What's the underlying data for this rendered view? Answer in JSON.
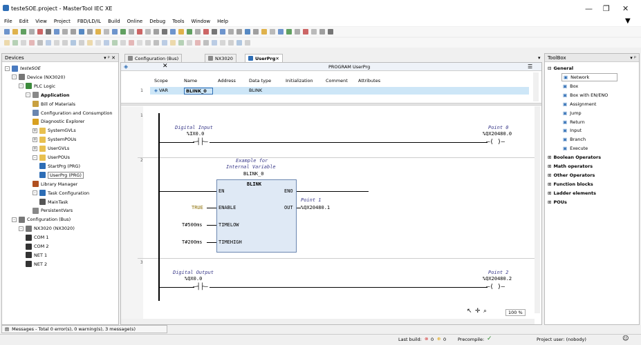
{
  "window": {
    "title": "testeSOE.project - MasterTool IEC XE"
  },
  "menu": [
    "File",
    "Edit",
    "View",
    "Project",
    "FBD/LD/IL",
    "Build",
    "Online",
    "Debug",
    "Tools",
    "Window",
    "Help"
  ],
  "devices_panel": {
    "title": "Devices",
    "tree": [
      {
        "label": "testeSOE",
        "level": 0,
        "icon": "project-icon",
        "exp": "-"
      },
      {
        "label": "Device (NX3020)",
        "level": 1,
        "icon": "device-icon",
        "exp": "-"
      },
      {
        "label": "PLC Logic",
        "level": 2,
        "icon": "plc-logic-icon",
        "exp": "-"
      },
      {
        "label": "Application",
        "level": 3,
        "icon": "application-icon",
        "exp": "-",
        "bold": true
      },
      {
        "label": "Bill of Materials",
        "level": 4,
        "icon": "bom-icon"
      },
      {
        "label": "Configuration and Consumption",
        "level": 4,
        "icon": "config-icon"
      },
      {
        "label": "Diagnostic Explorer",
        "level": 4,
        "icon": "diag-icon"
      },
      {
        "label": "SystemGVLs",
        "level": 4,
        "icon": "folder-icon",
        "exp": "+"
      },
      {
        "label": "SystemPOUs",
        "level": 4,
        "icon": "folder-icon",
        "exp": "+"
      },
      {
        "label": "UserGVLs",
        "level": 4,
        "icon": "folder-icon",
        "exp": "+"
      },
      {
        "label": "UserPOUs",
        "level": 4,
        "icon": "folder-icon",
        "exp": "-"
      },
      {
        "label": "StartPrg (PRG)",
        "level": 5,
        "icon": "prg-icon"
      },
      {
        "label": "UserPrg (PRG)",
        "level": 5,
        "icon": "prg-icon",
        "selected": true
      },
      {
        "label": "Library Manager",
        "level": 4,
        "icon": "library-icon"
      },
      {
        "label": "Task Configuration",
        "level": 4,
        "icon": "task-config-icon",
        "exp": "-"
      },
      {
        "label": "MainTask",
        "level": 5,
        "icon": "task-icon"
      },
      {
        "label": "PersistentVars",
        "level": 4,
        "icon": "persistent-icon"
      },
      {
        "label": "Configuration (Bus)",
        "level": 1,
        "icon": "bus-icon",
        "exp": "-"
      },
      {
        "label": "NX3020 (NX3020)",
        "level": 2,
        "icon": "device-icon",
        "exp": "-"
      },
      {
        "label": "COM 1",
        "level": 3,
        "icon": "port-icon"
      },
      {
        "label": "COM 2",
        "level": 3,
        "icon": "port-icon"
      },
      {
        "label": "NET 1",
        "level": 3,
        "icon": "port-icon"
      },
      {
        "label": "NET 2",
        "level": 3,
        "icon": "port-icon"
      }
    ]
  },
  "tabs": [
    {
      "label": "Configuration (Bus)",
      "active": false
    },
    {
      "label": "NX3020",
      "active": false
    },
    {
      "label": "UserPrg",
      "active": true
    }
  ],
  "editor": {
    "program_header": "PROGRAM UserPrg",
    "decl_headers": [
      "Scope",
      "Name",
      "Address",
      "Data type",
      "Initialization",
      "Comment",
      "Attributes"
    ],
    "decl_row": {
      "num": "1",
      "scope": "VAR",
      "name": "BLINK_0",
      "address": "",
      "datatype": "BLINK",
      "init": "",
      "comment": "",
      "attributes": ""
    },
    "networks": [
      {
        "num": "1",
        "contact_comment": "Digital Input",
        "contact_var": "%IX0.0",
        "coil_comment": "Point 0",
        "coil_var": "%QX20480.0"
      },
      {
        "num": "2",
        "fb_comment1": "Example for",
        "fb_comment2": "Internal Variable",
        "fb_instance": "BLINK_0",
        "fb_type": "BLINK",
        "in_en": "EN",
        "in_enable": "ENABLE",
        "in_timelow": "TIMELOW",
        "in_timehigh": "TIMEHIGH",
        "out_eno": "ENO",
        "out_out": "OUT",
        "val_enable": "TRUE",
        "val_timelow": "T#500ms",
        "val_timehigh": "T#200ms",
        "out_comment": "Point 1",
        "out_var": "%QX20480.1"
      },
      {
        "num": "3",
        "contact_comment": "Digital Output",
        "contact_var": "%QX0.0",
        "coil_comment": "Point 2",
        "coil_var": "%QX20480.2"
      }
    ],
    "zoom": "100 %"
  },
  "toolbox": {
    "title": "ToolBox",
    "general_label": "General",
    "general_items": [
      "Network",
      "Box",
      "Box with EN/ENO",
      "Assignment",
      "Jump",
      "Return",
      "Input",
      "Branch",
      "Execute"
    ],
    "groups": [
      "Boolean Operators",
      "Math operators",
      "Other Operators",
      "Function blocks",
      "Ladder elements",
      "POUs"
    ]
  },
  "messages_bar": "Messages - Total 0 error(s), 0 warning(s), 3 message(s)",
  "status": {
    "last_build_label": "Last build:",
    "errors": "0",
    "warnings": "0",
    "precompile_label": "Precompile:",
    "project_user": "Project user: (nobody)"
  },
  "colors": {
    "selection": "#cde6f7",
    "fb_fill": "#dfe9f5",
    "accent": "#1e5aa8"
  }
}
